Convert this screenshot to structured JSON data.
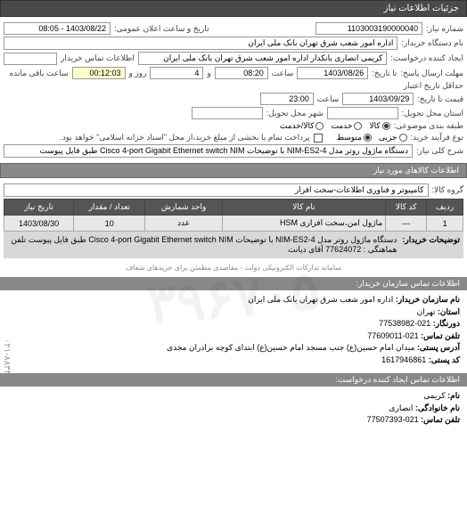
{
  "header": {
    "title": "جزئیات اطلاعات نیاز"
  },
  "req": {
    "number_label": "شماره نیاز:",
    "number": "1103003190000040",
    "announce_label": "تاریخ و ساعت اعلان عمومی:",
    "announce": "1403/08/22 - 08:05",
    "device_label": "نام دستگاه خریدار:",
    "device": "اداره امور شعب شرق تهران بانک ملی ایران",
    "creator_label": "ایجاد کننده درخواست:",
    "creator": "کریمی  انصاری  بانکدار  اداره امور شعب شرق تهران بانک ملی ایران",
    "buyer_contact_label": "اطلاعات تماس خریدار",
    "deadline_label": "مهلت ارسال پاسخ:",
    "deadline_until_label": "تا تاریخ:",
    "deadline_date": "1403/08/26",
    "hour_label": "ساعت",
    "deadline_hour": "08:20",
    "and_label": "و",
    "days_value": "4",
    "days_label": "روز و",
    "remain_value": "00:12:03",
    "remain_label": "ساعت باقی مانده",
    "price_valid_label": "حداقل تاریخ اعتبار",
    "price_until_label": "قیمت تا تاریخ:",
    "price_date": "1403/09/29",
    "price_hour": "23:00",
    "delivery_state_label": "استان محل تحویل:",
    "delivery_city_label": "شهر محل تحویل:",
    "packing_label": "طبقه بندی موضوعی:",
    "kala_label": "کالا",
    "service_label": "خدمت",
    "both_label": "کالا/خدمت",
    "process_label": "نوع فرآیند خرید:",
    "jozi_label": "جزیی",
    "motevaset_label": "متوسط",
    "payment_note": "پرداخت تمام یا بخشی از مبلغ خرید،از محل \"اسناد خزانه اسلامی\" خواهد بود.",
    "keyword_label": "شرح کلی نیاز:",
    "keyword": "دستگاه ماژول روتر مدل NIM-ES2-4 با توضیحات Cisco 4-port Gigabit Ethernet switch NIM طبق فایل پیوست"
  },
  "items_section_title": "اطلاعات کالاهای مورد نیاز",
  "group_label": "گروه کالا:",
  "group": "کامپیوتر و فناوری اطلاعات-سخت افزار",
  "table": {
    "headers": [
      "ردیف",
      "کد کالا",
      "نام کالا",
      "واحد شمارش",
      "تعداد / مقدار",
      "تاریخ نیاز"
    ],
    "row": [
      "1",
      "---",
      "ماژول امن،سخت افزاری HSM",
      "عدد",
      "10",
      "1403/08/30"
    ]
  },
  "desc": {
    "label": "توضیحات خریدار:",
    "text": "دستگاه ماژول روتر مدل NIM-ES2-4 با توضیحات Cisco 4-port Gigabit Ethernet switch NIM طبق فایل پیوست تلفن هماهنگی : 77624072 آقای دیانت"
  },
  "notice": "سامانه تدارکات الکترونیکی دولت - مقاصدی مطمئن برای خریدهای شفاف",
  "contact_header": "اطلاعات تماس سازمان خریدار:",
  "contact": {
    "org_label": "نام سازمان خریدار:",
    "org": "اداره امور شعب شرق تهران بانک ملی ایران",
    "province_label": "استان:",
    "province": "تهران",
    "fax_label": "دورنگار:",
    "fax": "021-77538982",
    "phone_label": "تلفن تماس:",
    "phone": "021-77609011",
    "address_label": "آدرس پستی:",
    "address": "میدان امام حسین(ع) جنب مسجد امام حسین(ع) ابتدای کوچه برادران مجدی",
    "postal_label": "کد پستی:",
    "postal": "1617946861"
  },
  "req_contact_header": "اطلاعات تماس ایجاد کننده درخواست:",
  "req_contact": {
    "name_label": "نام:",
    "name": "کریمی",
    "family_label": "نام خانوادگی:",
    "family": "انصاری",
    "phone_label": "تلفن تماس:",
    "phone": "021-77507393"
  },
  "watermark": "۳۹۶۷۰۵",
  "side_phone": "۰۲۱-۸۸۳۴"
}
